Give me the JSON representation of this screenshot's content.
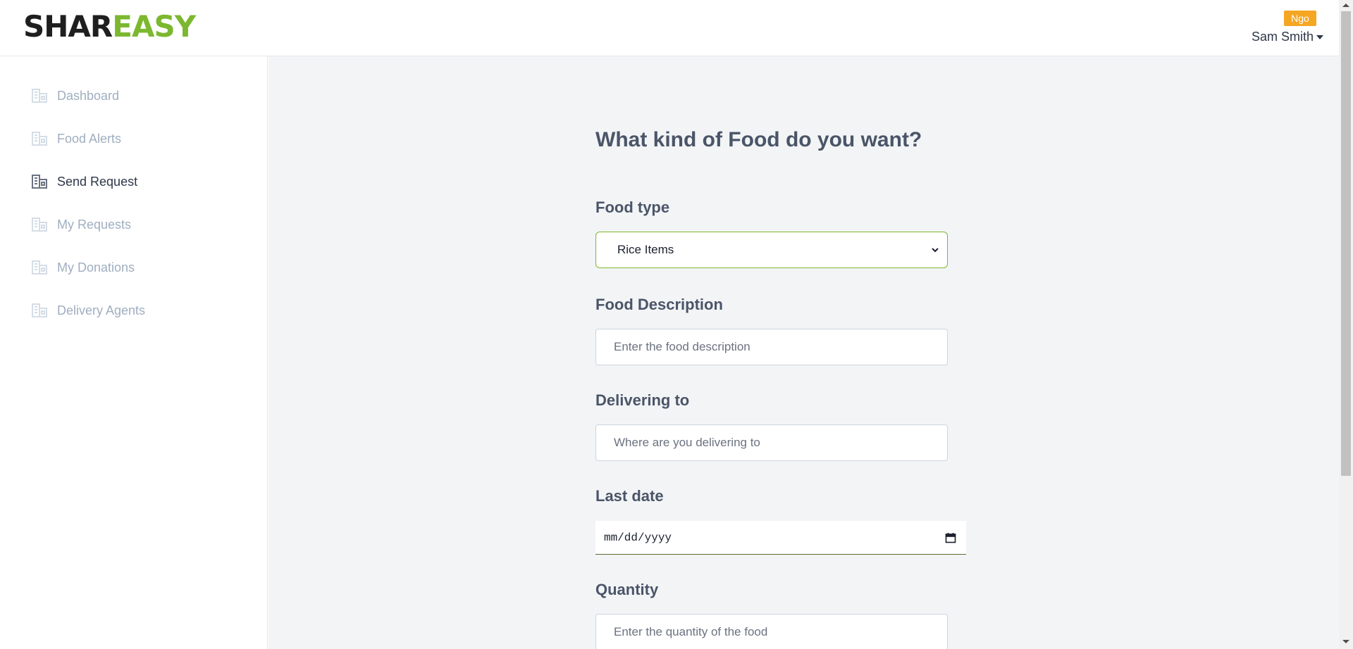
{
  "brand": {
    "part1": "SHAR",
    "part2": "EASY"
  },
  "user": {
    "role_badge": "Ngo",
    "name": "Sam Smith"
  },
  "sidebar": {
    "items": [
      {
        "label": "Dashboard",
        "active": false
      },
      {
        "label": "Food Alerts",
        "active": false
      },
      {
        "label": "Send Request",
        "active": true
      },
      {
        "label": "My Requests",
        "active": false
      },
      {
        "label": "My Donations",
        "active": false
      },
      {
        "label": "Delivery Agents",
        "active": false
      }
    ]
  },
  "form": {
    "title": "What kind of Food do you want?",
    "food_type": {
      "label": "Food type",
      "value": "Rice Items"
    },
    "food_description": {
      "label": "Food Description",
      "placeholder": "Enter the food description"
    },
    "delivering_to": {
      "label": "Delivering to",
      "placeholder": "Where are you delivering to"
    },
    "last_date": {
      "label": "Last date",
      "placeholder": "mm/dd/yyyy"
    },
    "quantity": {
      "label": "Quantity",
      "placeholder": "Enter the quantity of the food"
    }
  },
  "colors": {
    "accent": "#7cb82f",
    "badge": "#f5a623",
    "brand_dark": "#1f1f1f"
  }
}
